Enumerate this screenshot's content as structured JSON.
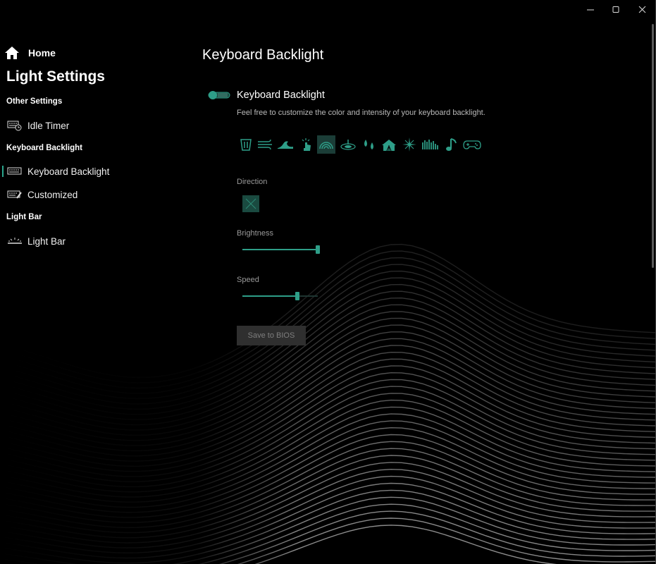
{
  "window": {
    "controls": [
      "minimize",
      "maximize",
      "close"
    ]
  },
  "sidebar": {
    "home_label": "Home",
    "title": "Light Settings",
    "sections": [
      {
        "header": "Other Settings",
        "items": [
          {
            "label": "Idle Timer",
            "icon": "idle-timer-icon",
            "active": false
          }
        ]
      },
      {
        "header": "Keyboard Backlight",
        "items": [
          {
            "label": "Keyboard Backlight",
            "icon": "keyboard-icon",
            "active": true
          },
          {
            "label": "Customized",
            "icon": "keyboard-edit-icon",
            "active": false
          }
        ]
      },
      {
        "header": "Light Bar",
        "items": [
          {
            "label": "Light Bar",
            "icon": "light-bar-icon",
            "active": false
          }
        ]
      }
    ]
  },
  "main": {
    "title": "Keyboard Backlight",
    "toggle_label": "Keyboard Backlight",
    "toggle_on": true,
    "description": "Feel free to customize the color and intensity of your keyboard backlight.",
    "effects": [
      "static-icon",
      "breathing-wind-icon",
      "wave-icon",
      "reactive-touch-icon",
      "rainbow-icon",
      "ripple-icon",
      "raindrop-icon",
      "circus-tent-icon",
      "starlight-icon",
      "aurora-icon",
      "music-icon",
      "game-controller-icon"
    ],
    "selected_effect_index": 4,
    "direction_label": "Direction",
    "direction_icon": "disabled-x-icon",
    "brightness_label": "Brightness",
    "brightness_value": 1.0,
    "speed_label": "Speed",
    "speed_value": 0.73,
    "save_button": "Save to BIOS"
  },
  "colors": {
    "accent": "#2e9e88",
    "accent_dark": "#1a4a40",
    "background": "#000000"
  }
}
